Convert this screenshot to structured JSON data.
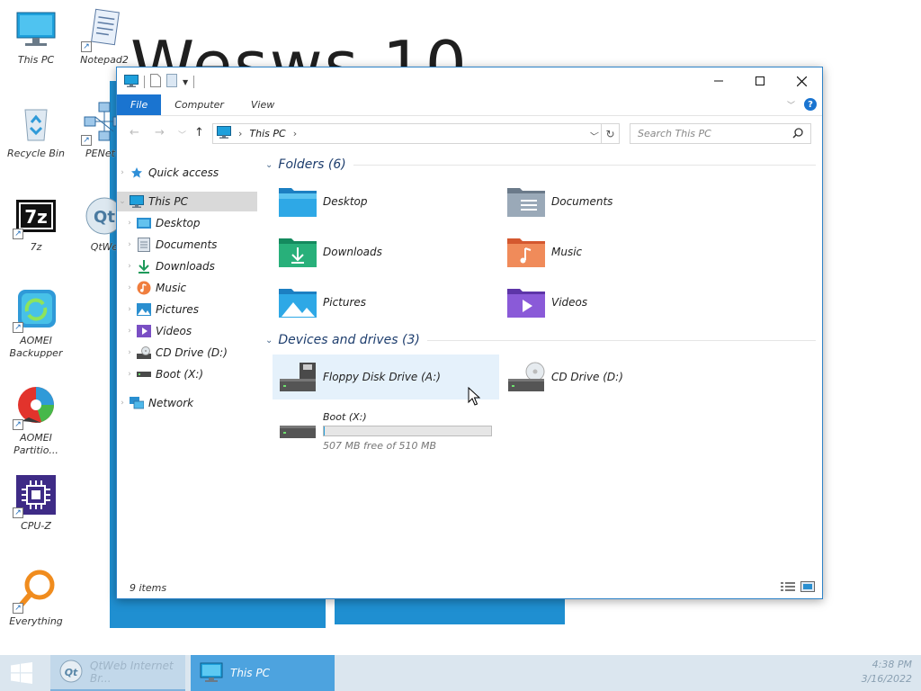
{
  "wallpaper": {
    "title": "Wesws 10"
  },
  "desktop": {
    "icons": [
      {
        "label": "This PC",
        "icon": "this-pc-icon"
      },
      {
        "label": "Notepad2",
        "icon": "notepad-icon"
      },
      {
        "label": "Recycle Bin",
        "icon": "recycle-bin-icon"
      },
      {
        "label": "PENetw",
        "icon": "network-icon"
      },
      {
        "label": "7z",
        "icon": "7zip-icon"
      },
      {
        "label": "QtWe",
        "icon": "qt-icon"
      },
      {
        "label": "AOMEI\nBackupper",
        "icon": "backupper-icon"
      },
      {
        "label": "AOMEI\nPartitio...",
        "icon": "partition-icon"
      },
      {
        "label": "CPU-Z",
        "icon": "cpu-z-icon"
      },
      {
        "label": "Everything",
        "icon": "everything-icon"
      }
    ]
  },
  "explorer": {
    "ribbon": {
      "tabs": [
        "File",
        "Computer",
        "View"
      ],
      "active_tab": "File",
      "help_label": "?"
    },
    "address": {
      "path": [
        "This PC"
      ],
      "separator": "›"
    },
    "search": {
      "placeholder": "Search This PC"
    },
    "nav_pane": {
      "items": [
        {
          "label": "Quick access",
          "icon": "star-icon"
        },
        {
          "label": "This PC",
          "icon": "this-pc-icon",
          "selected": true
        },
        {
          "label": "Desktop",
          "icon": "desktop-folder-icon"
        },
        {
          "label": "Documents",
          "icon": "documents-icon"
        },
        {
          "label": "Downloads",
          "icon": "download-icon"
        },
        {
          "label": "Music",
          "icon": "music-icon"
        },
        {
          "label": "Pictures",
          "icon": "pictures-icon"
        },
        {
          "label": "Videos",
          "icon": "videos-icon"
        },
        {
          "label": "CD Drive (D:)",
          "icon": "cd-drive-icon"
        },
        {
          "label": "Boot (X:)",
          "icon": "drive-icon"
        },
        {
          "label": "Network",
          "icon": "network-icon"
        }
      ]
    },
    "folders": {
      "header": "Folders (6)",
      "items": [
        {
          "label": "Desktop",
          "icon": "desktop-folder-icon"
        },
        {
          "label": "Documents",
          "icon": "documents-folder-icon"
        },
        {
          "label": "Downloads",
          "icon": "downloads-folder-icon"
        },
        {
          "label": "Music",
          "icon": "music-folder-icon"
        },
        {
          "label": "Pictures",
          "icon": "pictures-folder-icon"
        },
        {
          "label": "Videos",
          "icon": "videos-folder-icon"
        }
      ]
    },
    "devices": {
      "header": "Devices and drives (3)",
      "items": [
        {
          "label": "Floppy Disk Drive (A:)",
          "icon": "floppy-drive-icon"
        },
        {
          "label": "CD Drive (D:)",
          "icon": "cd-drive-icon"
        },
        {
          "label": "Boot (X:)",
          "icon": "drive-icon",
          "free_text": "507 MB free of 510 MB",
          "used_fraction": 0.006
        }
      ]
    },
    "status": {
      "items_count": "9 items"
    }
  },
  "taskbar": {
    "items": [
      {
        "label": "QtWeb Internet Br...",
        "icon": "qt-icon"
      },
      {
        "label": "This PC",
        "icon": "this-pc-icon",
        "active": true
      }
    ],
    "clock": {
      "time": "4:38 PM",
      "date": "3/16/2022"
    }
  },
  "colors": {
    "accent": "#1a74d0",
    "selection": "#d9d9d9",
    "hover": "#e5f1fb",
    "taskbar": "#dbe6ef",
    "taskbar_active": "#4da3df"
  }
}
